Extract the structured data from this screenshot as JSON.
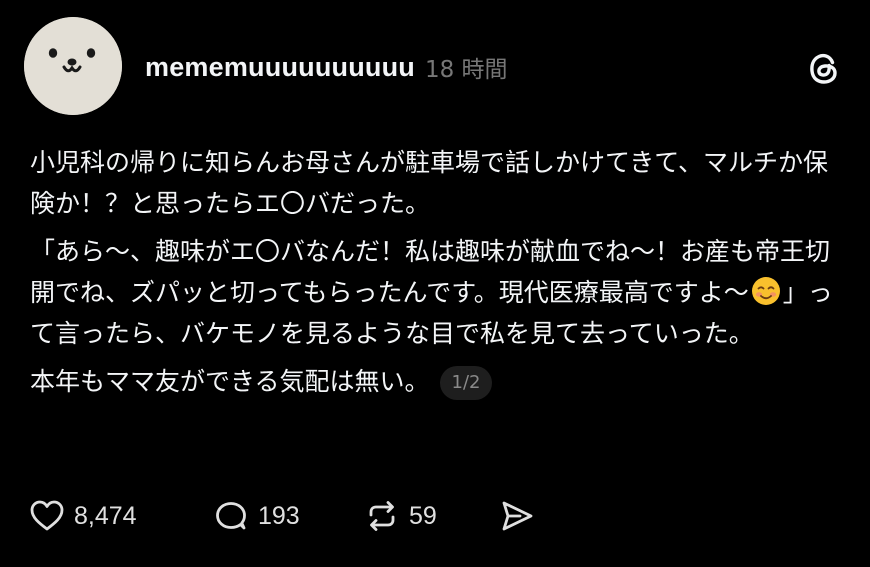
{
  "post": {
    "author": {
      "username": "mememuuuuuuuuuu",
      "avatar_icon": "seal-face-icon"
    },
    "timestamp": "18 時間",
    "app_icon": "threads-logo-icon",
    "paragraphs": [
      "小児科の帰りに知らんお母さんが駐車場で話しかけてきて、マルチか保険か！？と思ったらエ〇バだった。",
      "「あら〜、趣味がエ〇バなんだ！私は趣味が献血でね〜！お産も帝王切開でね、ズパッと切ってもらったんです。現代医療最高ですよ〜",
      "」って言ったら、バケモノを見るような目で私を見て去っていった。",
      "本年もママ友ができる気配は無い。"
    ],
    "emoji": "smiling-face-icon",
    "page_indicator": "1/2",
    "actions": {
      "likes": "8,474",
      "replies": "193",
      "reposts": "59",
      "share_icon": "send-icon"
    }
  },
  "colors": {
    "background": "#000000",
    "text": "#f3f5f7",
    "muted": "#777777",
    "badge_bg": "#1e1e1e",
    "avatar_bg": "#e3dfd6"
  }
}
